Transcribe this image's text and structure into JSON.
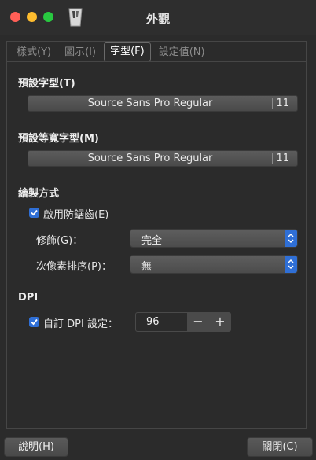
{
  "window": {
    "title": "外觀"
  },
  "tabs": [
    {
      "label": "樣式(Y)",
      "active": false
    },
    {
      "label": "圖示(I)",
      "active": false
    },
    {
      "label": "字型(F)",
      "active": true
    },
    {
      "label": "設定值(N)",
      "active": false
    }
  ],
  "fonts": {
    "default": {
      "title": "預設字型(T)",
      "name": "Source Sans Pro Regular",
      "size": "11"
    },
    "monospace": {
      "title": "預設等寬字型(M)",
      "name": "Source Sans Pro Regular",
      "size": "11"
    }
  },
  "rendering": {
    "title": "繪製方式",
    "antialias": {
      "label": "啟用防鋸齒(E)",
      "checked": true
    },
    "hinting": {
      "label": "修飾(G)：",
      "value": "完全"
    },
    "subpixel": {
      "label": "次像素排序(P)：",
      "value": "無"
    }
  },
  "dpi": {
    "title": "DPI",
    "custom": {
      "label": "自訂 DPI 設定：",
      "checked": true,
      "value": "96",
      "minus": "−",
      "plus": "+"
    }
  },
  "buttons": {
    "help": "說明(H)",
    "close": "關閉(C)"
  },
  "colors": {
    "accent": "#2f6fd6",
    "background": "#2b2b2b"
  }
}
